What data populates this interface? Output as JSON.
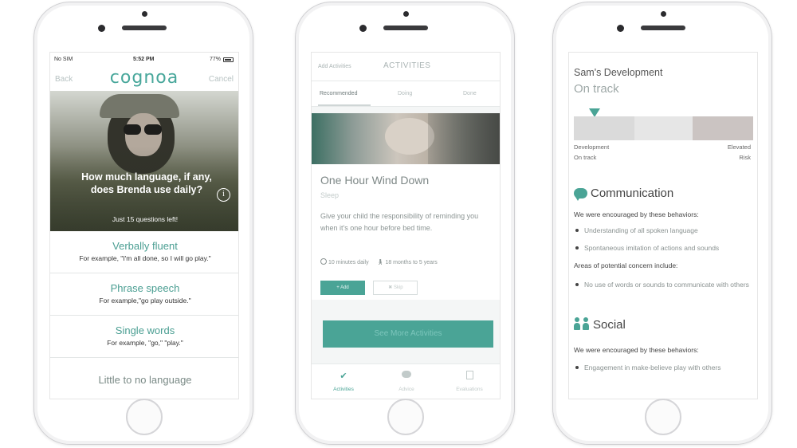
{
  "screen1": {
    "status": {
      "carrier": "No SIM",
      "time": "5:52 PM",
      "battery": "77%"
    },
    "nav": {
      "back": "Back",
      "logo": "cognoa",
      "cancel": "Cancel"
    },
    "question": "How much language, if any, does Brenda use daily?",
    "questions_left": "Just 15 questions left!",
    "info_icon": "info-icon",
    "answers": [
      {
        "title": "Verbally fluent",
        "example": "For example, \"I'm all done, so I will go play.\""
      },
      {
        "title": "Phrase speech",
        "example": "For example,\"go play outside.\""
      },
      {
        "title": "Single words",
        "example": "For example, \"go,\" \"play.\""
      },
      {
        "title": "Little to no language",
        "example": ""
      }
    ]
  },
  "screen2": {
    "add_activities": "Add Activities",
    "title": "ACTIVITIES",
    "tabs": [
      "Recommended",
      "Doing",
      "Done"
    ],
    "card": {
      "title": "One Hour Wind Down",
      "category": "Sleep",
      "description": "Give your child the responsibility of reminding you when it's one hour before bed time.",
      "duration": "10 minutes daily",
      "age": "18 months to 5 years",
      "add_label": "Add",
      "skip_label": "Skip"
    },
    "see_more": "See More Activities",
    "bottom_nav": [
      {
        "label": "Activities",
        "icon": "check-icon"
      },
      {
        "label": "Advice",
        "icon": "chat-bubble-icon"
      },
      {
        "label": "Evaluations",
        "icon": "document-icon"
      }
    ]
  },
  "screen3": {
    "title": "Sam's Development",
    "status": "On track",
    "bar_left_label": [
      "Development",
      "On track"
    ],
    "bar_right_label": [
      "Elevated",
      "Risk"
    ],
    "communication": {
      "heading": "Communication",
      "encouraged_intro": "We were encouraged by these behaviors:",
      "encouraged": [
        "Understanding of all spoken language",
        "Spontaneous imitation of actions and sounds"
      ],
      "concern_intro": "Areas of potential concern include:",
      "concerns": [
        "No use of words or sounds to communicate with others"
      ]
    },
    "social": {
      "heading": "Social",
      "encouraged_intro": "We were encouraged by these behaviors:",
      "encouraged": [
        "Engagement in make-believe play with others"
      ]
    }
  },
  "colors": {
    "accent": "#4aa496",
    "muted": "#a9b3b3"
  }
}
